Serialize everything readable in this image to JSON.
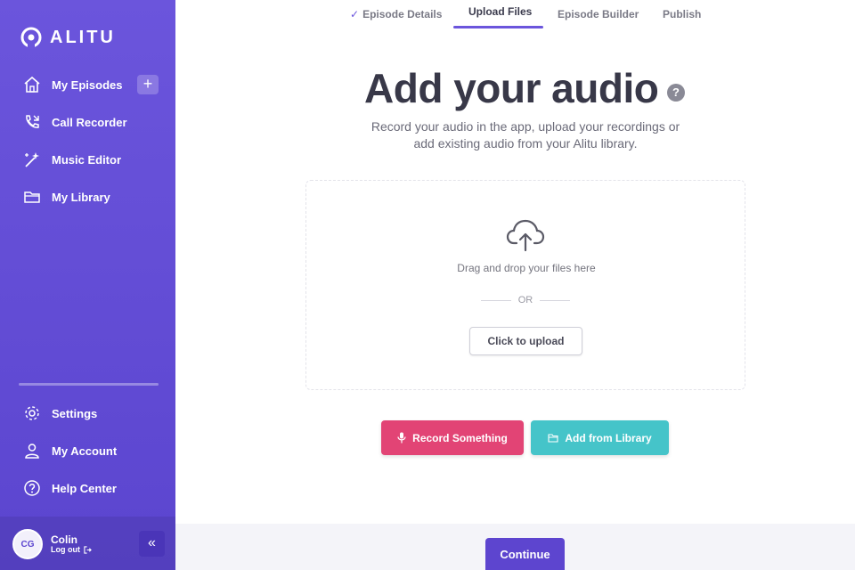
{
  "brand": {
    "name": "ALITU"
  },
  "sidebar": {
    "items": [
      {
        "label": "My Episodes",
        "icon": "home-icon"
      },
      {
        "label": "Call Recorder",
        "icon": "phone-icon"
      },
      {
        "label": "Music Editor",
        "icon": "wand-icon"
      },
      {
        "label": "My Library",
        "icon": "folder-icon"
      }
    ],
    "add_label": "+",
    "bottom_items": [
      {
        "label": "Settings",
        "icon": "gear-icon"
      },
      {
        "label": "My Account",
        "icon": "user-icon"
      },
      {
        "label": "Help Center",
        "icon": "help-circle-icon"
      }
    ],
    "user": {
      "initials": "CG",
      "name": "Colin",
      "logout_label": "Log out"
    },
    "collapse_label": "«"
  },
  "tabs": [
    {
      "label": "Episode Details",
      "state": "done"
    },
    {
      "label": "Upload Files",
      "state": "active"
    },
    {
      "label": "Episode Builder",
      "state": "pending"
    },
    {
      "label": "Publish",
      "state": "pending"
    }
  ],
  "main": {
    "title": "Add your audio",
    "help_label": "?",
    "subtitle_line1": "Record your audio in the app, upload your recordings or",
    "subtitle_line2": "add existing audio from your Alitu library.",
    "drop_text": "Drag and drop your files here",
    "or_label": "OR",
    "upload_label": "Click to upload",
    "record_label": "Record Something",
    "library_label": "Add from Library",
    "continue_label": "Continue"
  },
  "colors": {
    "sidebar": "#6b55dc",
    "record": "#e24475",
    "library": "#45c4c9",
    "accent": "#5d45cf"
  }
}
